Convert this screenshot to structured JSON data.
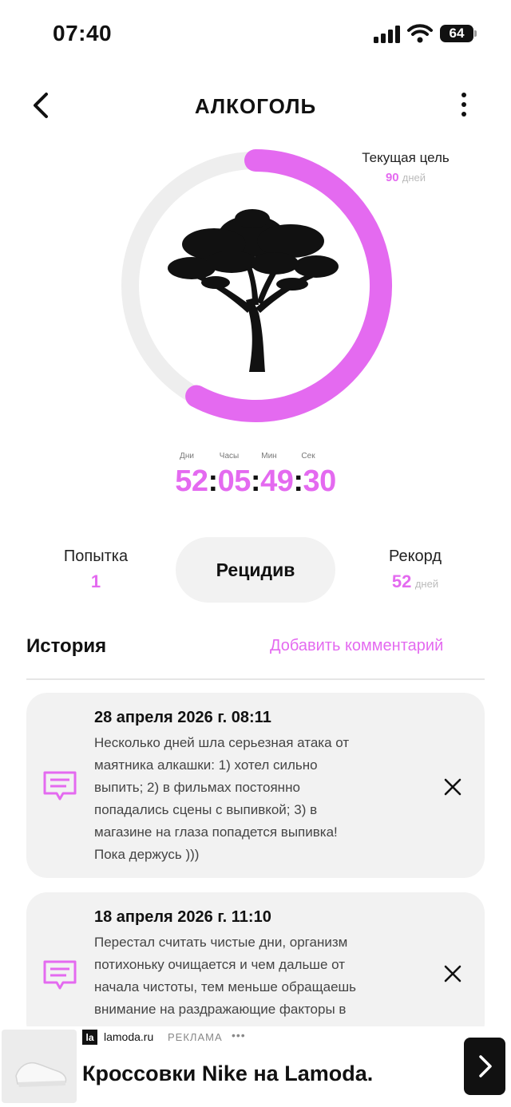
{
  "status_bar": {
    "time": "07:40",
    "battery": "64"
  },
  "header": {
    "title": "АЛКОГОЛЬ"
  },
  "goal": {
    "label": "Текущая цель",
    "value": "90",
    "unit": "дней",
    "progress": 0.578
  },
  "timer": {
    "labels": {
      "days": "Дни",
      "hours": "Часы",
      "minutes": "Мин",
      "seconds": "Сек"
    },
    "days": "52",
    "hours": "05",
    "minutes": "49",
    "seconds": "30"
  },
  "stats": {
    "attempt_label": "Попытка",
    "attempt_value": "1",
    "relapse_button": "Рецидив",
    "record_label": "Рекорд",
    "record_value": "52",
    "record_unit": "дней"
  },
  "history": {
    "title": "История",
    "add_comment": "Добавить комментарий",
    "entries": [
      {
        "date": "28 апреля 2026 г. 08:11",
        "lines": [
          "Несколько дней шла серьезная атака от",
          "маятника алкашки: 1) хотел сильно",
          "выпить; 2) в фильмах постоянно",
          "попадались сцены с выпивкой; 3) в",
          "магазине на глаза попадется выпивка!",
          "Пока держусь )))"
        ]
      },
      {
        "date": "18 апреля 2026 г. 11:10",
        "lines": [
          "Перестал считать чистые дни, организм",
          "потихоньку очищается и чем дальше от",
          "начала чистоты, тем меньше обращаешь",
          "внимание на раздражающие факторы в"
        ]
      }
    ]
  },
  "ad": {
    "logo": "la",
    "site": "lamoda.ru",
    "label": "РЕКЛАМА",
    "dots": "•••",
    "title": "Кроссовки Nike на Lamoda."
  },
  "colors": {
    "accent": "#e46af0",
    "ring_track": "#eeeeee",
    "card_bg": "#f2f2f2"
  }
}
